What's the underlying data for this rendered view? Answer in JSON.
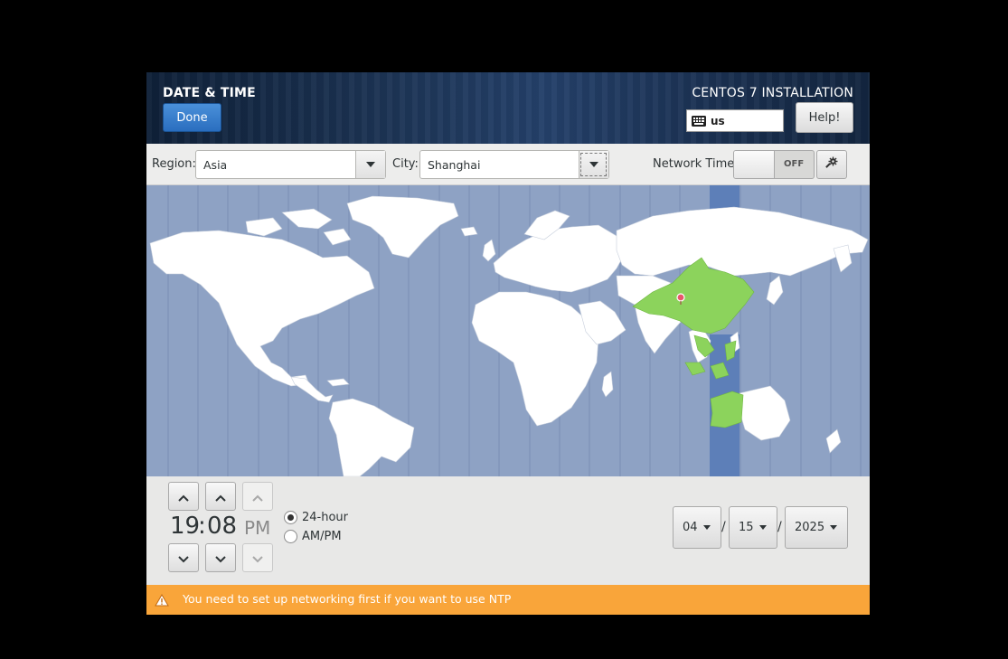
{
  "header": {
    "spoke_title": "DATE & TIME",
    "done_label": "Done",
    "product_title": "CENTOS 7 INSTALLATION",
    "keyboard_layout": "us",
    "help_label": "Help!"
  },
  "toolbar": {
    "region_label": "Region:",
    "region_value": "Asia",
    "city_label": "City:",
    "city_value": "Shanghai",
    "network_time_label": "Network Time",
    "network_time_state": "OFF"
  },
  "map": {
    "selected_zone_color": "#8cd35c",
    "selected_band_color": "#5d7fb8",
    "ocean_color": "#8ea2c4",
    "marker_icon": "location-pin-icon"
  },
  "time": {
    "hours": "19",
    "separator": ":",
    "minutes": "08",
    "ampm": "PM",
    "format_24h_label": "24-hour",
    "format_ampm_label": "AM/PM",
    "format_selected": "24-hour"
  },
  "date": {
    "month": "04",
    "day": "15",
    "year": "2025",
    "separator": "/"
  },
  "warning": {
    "icon": "warning-icon",
    "message": "You need to set up networking first if you want to use NTP",
    "color": "#f9a53a"
  }
}
